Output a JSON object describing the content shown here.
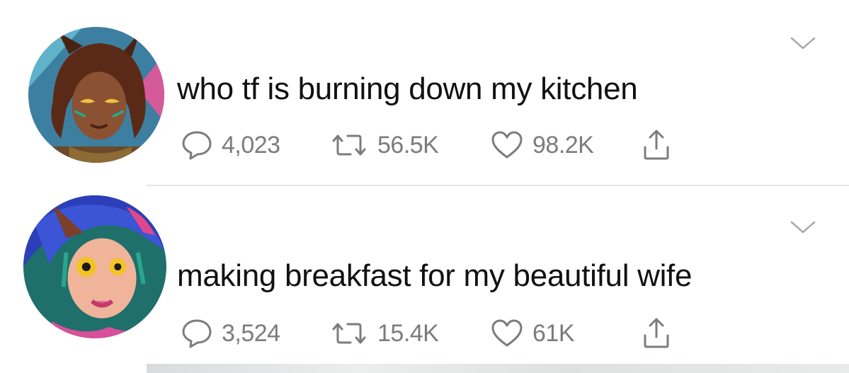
{
  "tweets": [
    {
      "text": "who tf is burning down my kitchen",
      "replies": "4,023",
      "retweets": "56.5K",
      "likes": "98.2K",
      "avatar_icon": "character-avatar-icon"
    },
    {
      "text": "making breakfast for my beautiful wife",
      "replies": "3,524",
      "retweets": "15.4K",
      "likes": "61K",
      "avatar_icon": "character-avatar-icon"
    }
  ],
  "icons": {
    "reply": "reply-bubble-icon",
    "retweet": "retweet-arrows-icon",
    "like": "heart-icon",
    "share": "share-upload-icon",
    "menu": "chevron-down-icon"
  },
  "colors": {
    "text": "#111111",
    "meta": "#7b7b80",
    "divider": "#e4e6e8"
  }
}
